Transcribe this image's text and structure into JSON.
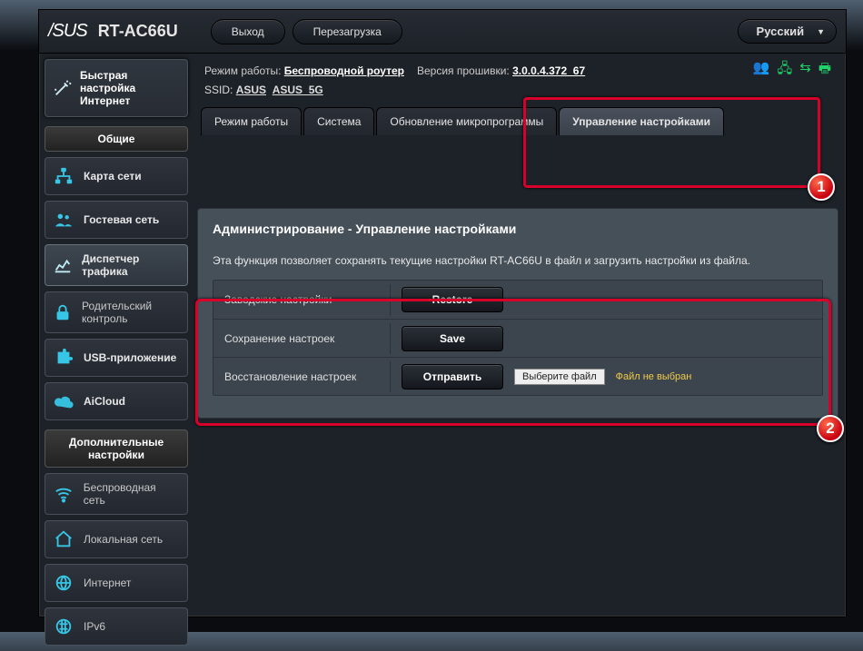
{
  "header": {
    "brand": "/SUS",
    "model": "RT-AC66U",
    "logout": "Выход",
    "reboot": "Перезагрузка",
    "language": "Русский"
  },
  "status": {
    "mode_label": "Режим работы:",
    "mode_value": "Беспроводной роутер",
    "fw_label": "Версия прошивки:",
    "fw_value": "3.0.0.4.372_67",
    "ssid_label": "SSID:",
    "ssid_a": "ASUS",
    "ssid_b": "ASUS_5G"
  },
  "sidebar": {
    "qis": "Быстрая настройка Интернет",
    "general_head": "Общие",
    "general": [
      "Карта сети",
      "Гостевая сеть",
      "Диспетчер трафика",
      "Родительский контроль",
      "USB-приложение",
      "AiCloud"
    ],
    "advanced_head": "Дополнительные настройки",
    "advanced": [
      "Беспроводная сеть",
      "Локальная сеть",
      "Интернет",
      "IPv6"
    ]
  },
  "tabs": [
    "Режим работы",
    "Система",
    "Обновление микропрограммы",
    "Управление настройками"
  ],
  "panel": {
    "title": "Администрирование - Управление настройками",
    "desc": "Эта функция позволяет сохранять текущие настройки RT-AC66U в файл и загрузить настройки из файла.",
    "rows": {
      "restore_label": "Заводские настройки",
      "restore_btn": "Restore",
      "save_label": "Сохранение настроек",
      "save_btn": "Save",
      "upload_label": "Восстановление настроек",
      "upload_btn": "Отправить",
      "choose_file": "Выберите файл",
      "no_file": "Файл не выбран"
    }
  },
  "badges": {
    "one": "1",
    "two": "2"
  }
}
